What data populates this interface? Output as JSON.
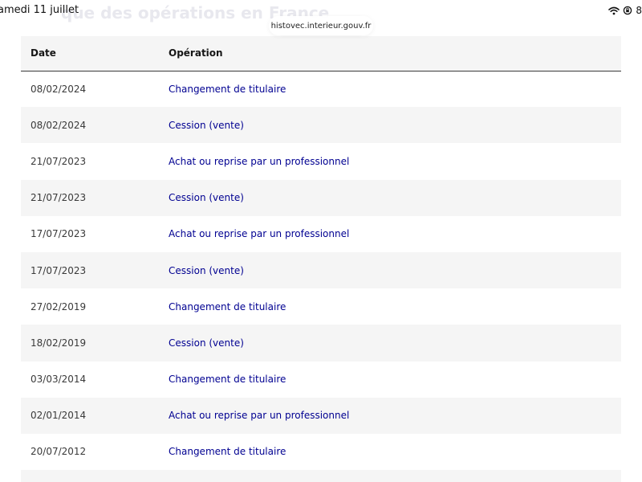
{
  "status_bar": {
    "time": "amedi 11 juillet",
    "battery": "8"
  },
  "browser": {
    "url": "histovec.interieur.gouv.fr"
  },
  "page": {
    "ghost_title": "que des opérations en France"
  },
  "table": {
    "headers": [
      "Date",
      "Opération"
    ],
    "rows": [
      {
        "date": "08/02/2024",
        "operation": "Changement de titulaire"
      },
      {
        "date": "08/02/2024",
        "operation": "Cession (vente)"
      },
      {
        "date": "21/07/2023",
        "operation": "Achat ou reprise par un professionnel"
      },
      {
        "date": "21/07/2023",
        "operation": "Cession (vente)"
      },
      {
        "date": "17/07/2023",
        "operation": "Achat ou reprise par un professionnel"
      },
      {
        "date": "17/07/2023",
        "operation": "Cession (vente)"
      },
      {
        "date": "27/02/2019",
        "operation": "Changement de titulaire"
      },
      {
        "date": "18/02/2019",
        "operation": "Cession (vente)"
      },
      {
        "date": "03/03/2014",
        "operation": "Changement de titulaire"
      },
      {
        "date": "02/01/2014",
        "operation": "Achat ou reprise par un professionnel"
      },
      {
        "date": "20/07/2012",
        "operation": "Changement de titulaire"
      },
      {
        "date": "",
        "operation": ""
      }
    ]
  },
  "colors": {
    "link": "#000091",
    "stripe": "#f5f5f5"
  },
  "icons": {
    "wifi": "wifi-icon",
    "orientation_lock": "orientation-lock-icon"
  }
}
